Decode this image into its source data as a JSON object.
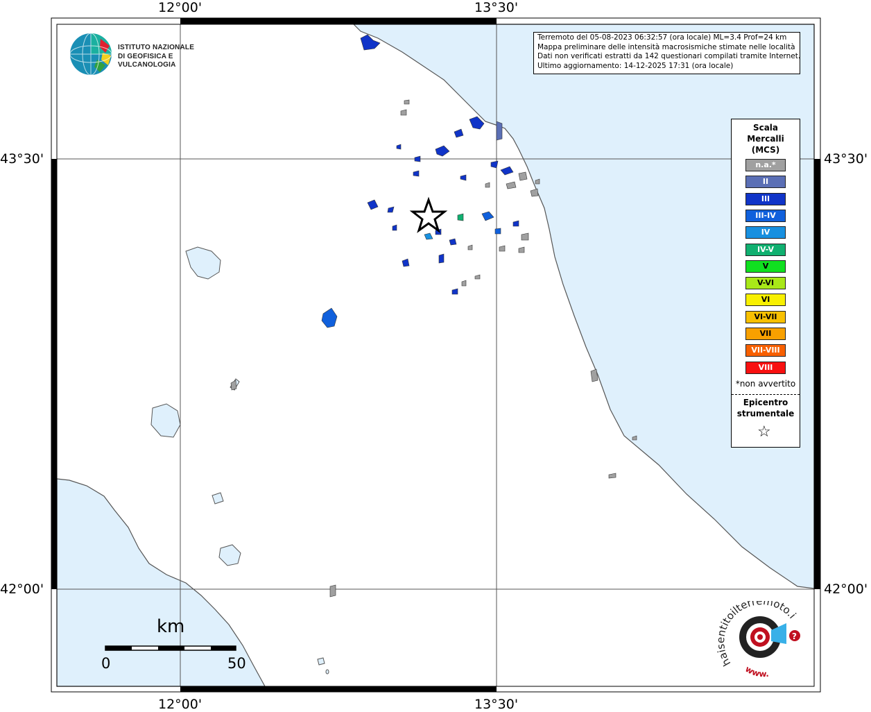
{
  "axes": {
    "top_lon": [
      "12°00'",
      "13°30'"
    ],
    "bottom_lon": [
      "12°00'",
      "13°30'"
    ],
    "left_lat": [
      "43°30'",
      "42°00'"
    ],
    "right_lat": [
      "43°30'",
      "42°00'"
    ]
  },
  "info": {
    "line1": "Terremoto del 05-08-2023 06:32:57 (ora locale) ML=3.4 Prof=24 km",
    "line2": "Mappa preliminare delle intensità macrosismiche stimate nelle località",
    "line3": "Dati non verificati estratti da 142 questionari compilati tramite Internet.",
    "line4": "Ultimo aggiornamento: 14-12-2025 17:31 (ora locale)"
  },
  "logo": {
    "line1": "ISTITUTO NAZIONALE",
    "line2": "DI GEOFISICA E VULCANOLOGIA"
  },
  "legend": {
    "title1": "Scala",
    "title2": "Mercalli",
    "title3": "(MCS)",
    "items": [
      {
        "label": "n.a.*",
        "color": "#a0a0a0"
      },
      {
        "label": "II",
        "color": "#5b6fb5"
      },
      {
        "label": "III",
        "color": "#1034c8"
      },
      {
        "label": "III-IV",
        "color": "#1060dc"
      },
      {
        "label": "IV",
        "color": "#1890e0"
      },
      {
        "label": "IV-V",
        "color": "#10b070"
      },
      {
        "label": "V",
        "color": "#10e020"
      },
      {
        "label": "V-VI",
        "color": "#a8e818"
      },
      {
        "label": "VI",
        "color": "#f8f000"
      },
      {
        "label": "VI-VII",
        "color": "#f8c000"
      },
      {
        "label": "VII",
        "color": "#f8a000"
      },
      {
        "label": "VII-VIII",
        "color": "#f86000"
      },
      {
        "label": "VIII",
        "color": "#f81010"
      }
    ],
    "na_note": "*non avvertito",
    "epi1": "Epicentro",
    "epi2": "strumentale",
    "epi_symbol": "☆"
  },
  "scalebar": {
    "unit": "km",
    "start": "0",
    "end": "50"
  },
  "hst": {
    "text": "haisentitoilterremoto.it",
    "www": "www.",
    "q": "?"
  },
  "colors": {
    "sea": "#dff0fc",
    "land": "#ffffff",
    "na": "#a0a0a0",
    "ii": "#5b6fb5",
    "iii": "#1034c8",
    "iiiiv": "#1060dc",
    "iv": "#1890e0"
  }
}
